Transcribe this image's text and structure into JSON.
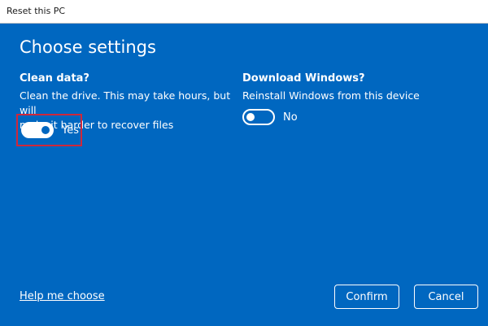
{
  "window": {
    "title": "Reset this PC"
  },
  "main": {
    "heading": "Choose settings",
    "clean_data": {
      "title": "Clean data?",
      "description_line1": "Clean the drive. This may take hours, but will",
      "description_line2": "make it harder to recover files",
      "toggle_state": "on",
      "toggle_label": "Yes"
    },
    "download_windows": {
      "title": "Download Windows?",
      "description": "Reinstall Windows from this device",
      "toggle_state": "off",
      "toggle_label": "No"
    }
  },
  "footer": {
    "help_link": "Help me choose",
    "confirm_label": "Confirm",
    "cancel_label": "Cancel"
  },
  "colors": {
    "background": "#0067c0",
    "highlight": "#d0283a"
  }
}
